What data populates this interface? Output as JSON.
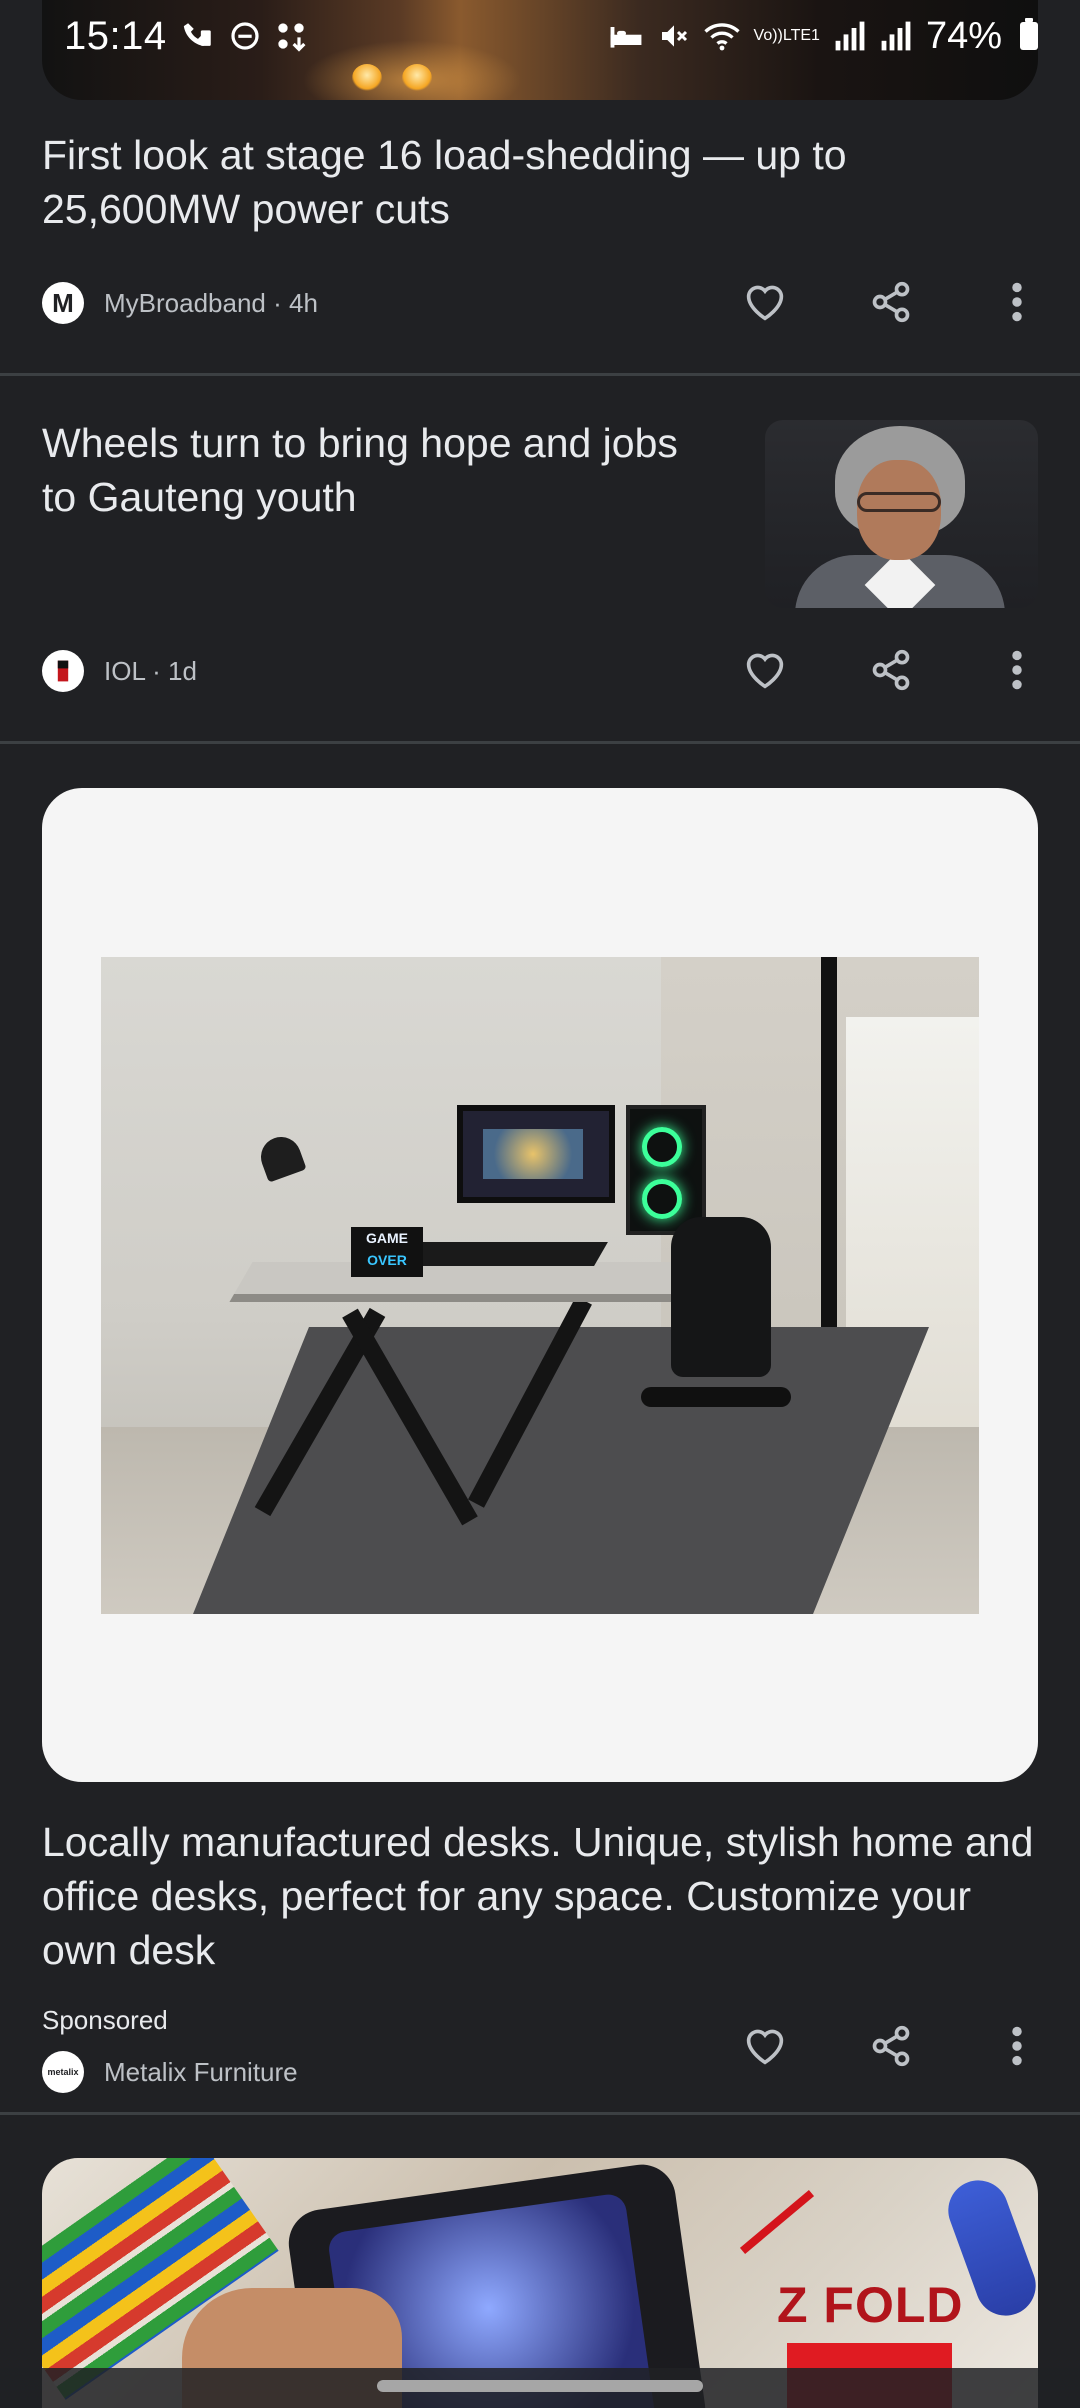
{
  "status_bar": {
    "time": "15:14",
    "network_label_top": "Vo))",
    "network_label_bottom": "LTE1",
    "battery": "74%"
  },
  "feed": [
    {
      "headline": "First look at stage 16 load-shedding — up to 25,600MW power cuts",
      "source_logo": "M",
      "source": "MyBroadband · 4h"
    },
    {
      "headline": "Wheels turn to bring hope and jobs to Gauteng youth",
      "source": "IOL · 1d"
    }
  ],
  "sponsored": {
    "sign_line1": "GAME",
    "sign_line2": "OVER",
    "headline": "Locally manufactured desks. Unique, stylish home and office desks, perfect for any space. Customize your own desk",
    "label": "Sponsored",
    "advertiser": "Metalix Furniture",
    "advertiser_logo": "metalix"
  },
  "next_card": {
    "overlay_text": "Z FOLD"
  },
  "icons": {
    "like": "heart-icon",
    "share": "share-icon",
    "more": "more-vert-icon"
  }
}
